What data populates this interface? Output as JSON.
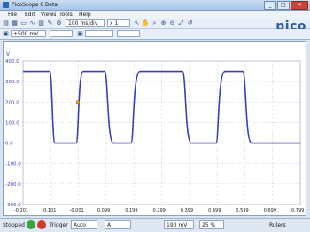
{
  "window": {
    "title": "PicoScope 6 Beta"
  },
  "menu": {
    "items": [
      "File",
      "Edit",
      "Views",
      "Tools",
      "Help"
    ]
  },
  "toolbar": {
    "timebase": "100 ms/div",
    "multiplier": "x 1",
    "channel_range": "±500 mV",
    "logo": "pico"
  },
  "scope": {
    "axis_unit": "V",
    "y_ticks": [
      "400.0",
      "300.0",
      "200.0",
      "100.0",
      "0.0",
      "-100.0",
      "-200.0",
      "-300.0"
    ],
    "x_ticks": [
      "-0.201",
      "-0.101",
      "-0.001",
      "0.099",
      "0.199",
      "0.299",
      "0.399",
      "0.499",
      "0.599",
      "0.699",
      "0.799"
    ],
    "trace_color": "#3b3fb6"
  },
  "status": {
    "run_state": "Stopped",
    "trigger_label": "Trigger",
    "trigger_mode": "Auto",
    "channel": "A",
    "level": "190 mV",
    "pre_trigger": "25 %",
    "ruler_label": "Rulers"
  }
}
